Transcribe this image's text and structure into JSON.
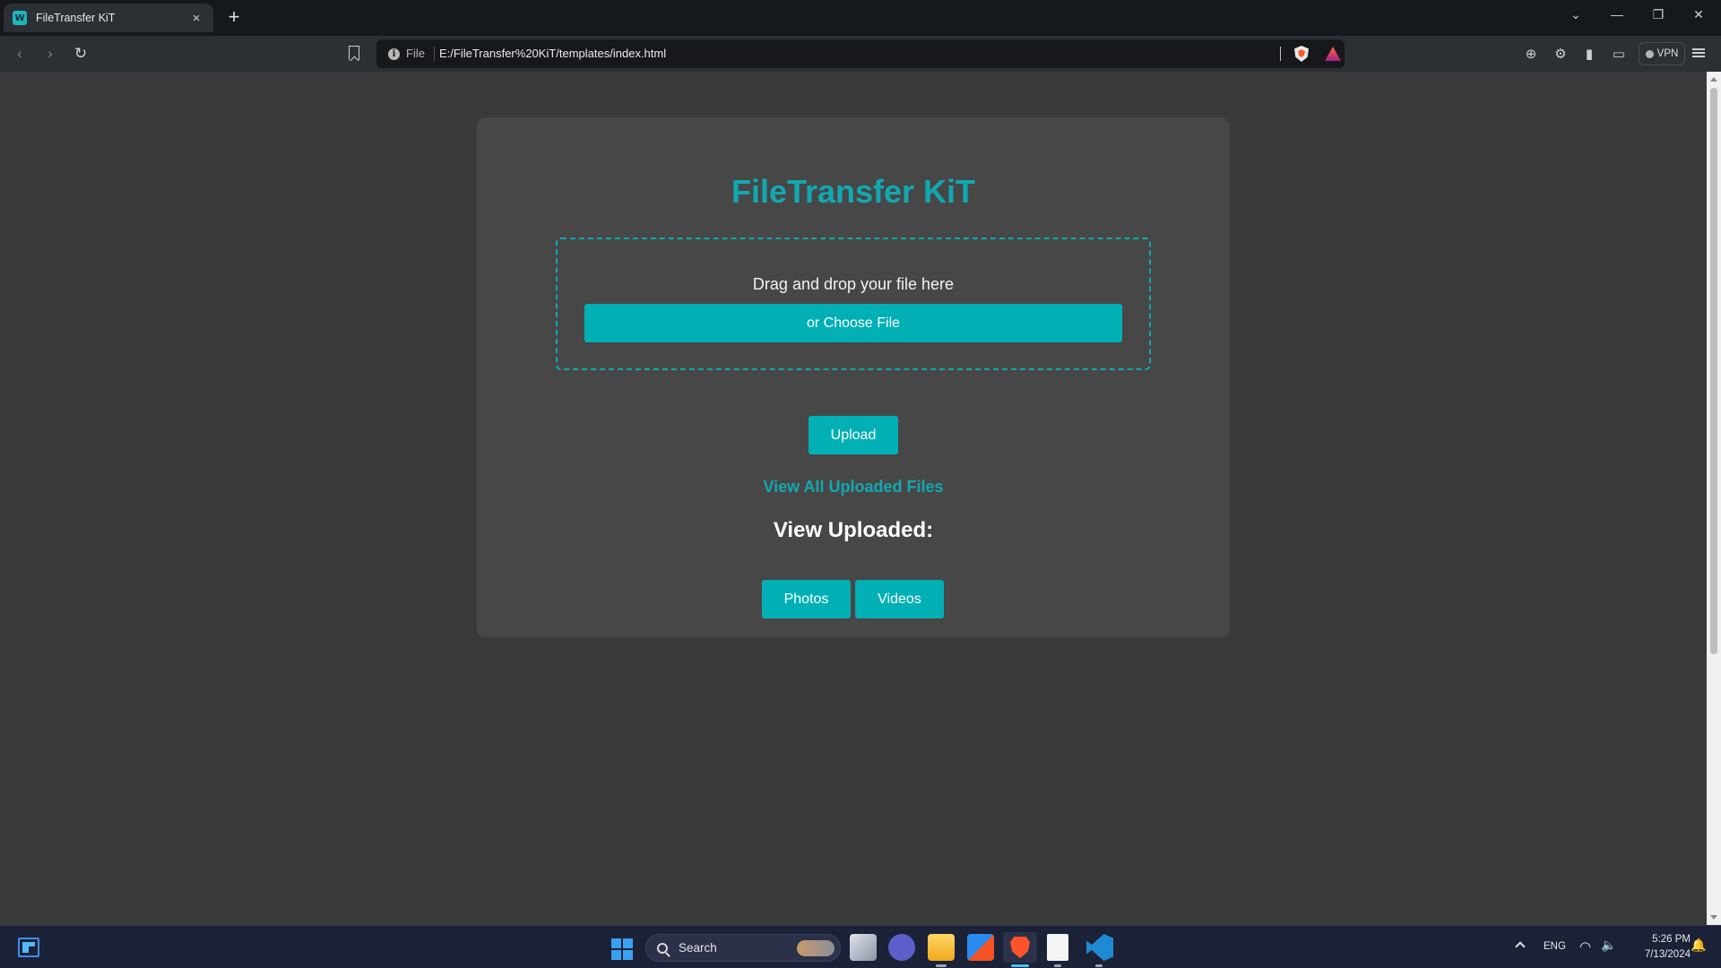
{
  "browser": {
    "tab": {
      "title": "FileTransfer KiT",
      "favicon": "filetransfer-logo",
      "close": "×"
    },
    "new_tab": "+",
    "window_controls": {
      "tab_search": "⌄",
      "minimize": "—",
      "restore": "❐",
      "close": "✕"
    },
    "nav": {
      "back": "‹",
      "forward": "›",
      "reload": "↻"
    },
    "address": {
      "scheme_label": "File",
      "url": "E:/FileTransfer%20KiT/templates/index.html"
    },
    "vpn_label": "VPN"
  },
  "page": {
    "title": "FileTransfer KiT",
    "dropzone_text": "Drag and drop your file here",
    "choose_file_label": "or Choose File",
    "upload_label": "Upload",
    "view_all_link": "View All Uploaded Files",
    "view_uploaded_heading": "View Uploaded:",
    "media_buttons": [
      "Photos",
      "Videos"
    ]
  },
  "taskbar": {
    "search_label": "Search",
    "language": "ENG",
    "time": "5:26 PM",
    "date": "7/13/2024"
  },
  "colors": {
    "accent": "#11a9b1",
    "button": "#01b0b5",
    "card": "#474747",
    "background": "#3a3a3a"
  }
}
